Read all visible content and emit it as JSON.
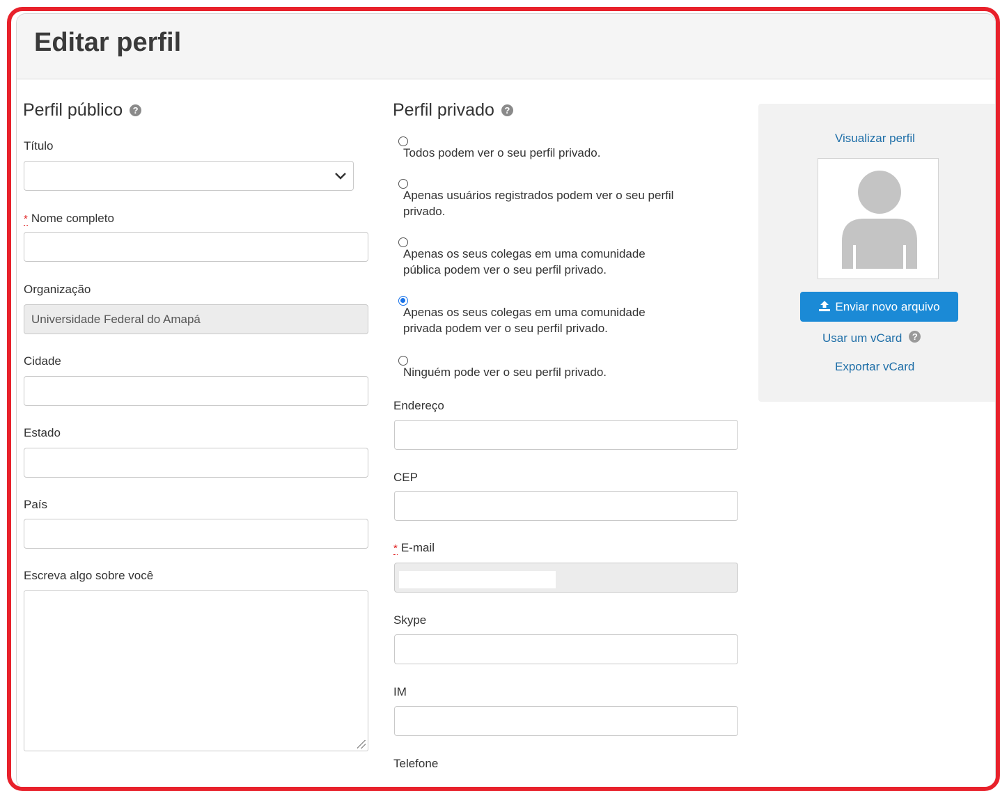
{
  "page": {
    "title": "Editar perfil"
  },
  "public_profile": {
    "title": "Perfil público",
    "help_icon": "?",
    "fields": {
      "titulo": {
        "label": "Título",
        "value": ""
      },
      "nome": {
        "required_mark": "*",
        "label": "Nome completo",
        "value": ""
      },
      "organizacao": {
        "label": "Organização",
        "value": "Universidade Federal do Amapá"
      },
      "cidade": {
        "label": "Cidade",
        "value": ""
      },
      "estado": {
        "label": "Estado",
        "value": ""
      },
      "pais": {
        "label": "País",
        "value": ""
      },
      "sobre": {
        "label": "Escreva algo sobre você",
        "value": ""
      }
    }
  },
  "private_profile": {
    "title": "Perfil privado",
    "help_icon": "?",
    "visibility_options": [
      {
        "label": "Todos podem ver o seu perfil privado.",
        "checked": false
      },
      {
        "label": "Apenas usuários registrados podem ver o seu perfil privado.",
        "checked": false
      },
      {
        "label": "Apenas os seus colegas em uma comunidade pública podem ver o seu perfil privado.",
        "checked": false
      },
      {
        "label": "Apenas os seus colegas em uma comunidade privada podem ver o seu perfil privado.",
        "checked": true
      },
      {
        "label": "Ninguém pode ver o seu perfil privado.",
        "checked": false
      }
    ],
    "fields": {
      "endereco": {
        "label": "Endereço",
        "value": ""
      },
      "cep": {
        "label": "CEP",
        "value": ""
      },
      "email": {
        "required_mark": "*",
        "label": "E-mail",
        "value": ""
      },
      "skype": {
        "label": "Skype",
        "value": ""
      },
      "im": {
        "label": "IM",
        "value": ""
      },
      "telefone": {
        "label": "Telefone"
      }
    }
  },
  "sidebar": {
    "view_profile_link": "Visualizar perfil",
    "avatar_icon": "default-user-icon",
    "upload_button": "Enviar novo arquivo",
    "upload_icon": "upload-icon",
    "vcard_link": "Usar um vCard",
    "vcard_help": "?",
    "export_link": "Exportar vCard"
  },
  "colors": {
    "frame_border": "#e8212b",
    "accent": "#1b8ad6",
    "link": "#1f6fa8",
    "header_bg": "#f5f5f5"
  }
}
